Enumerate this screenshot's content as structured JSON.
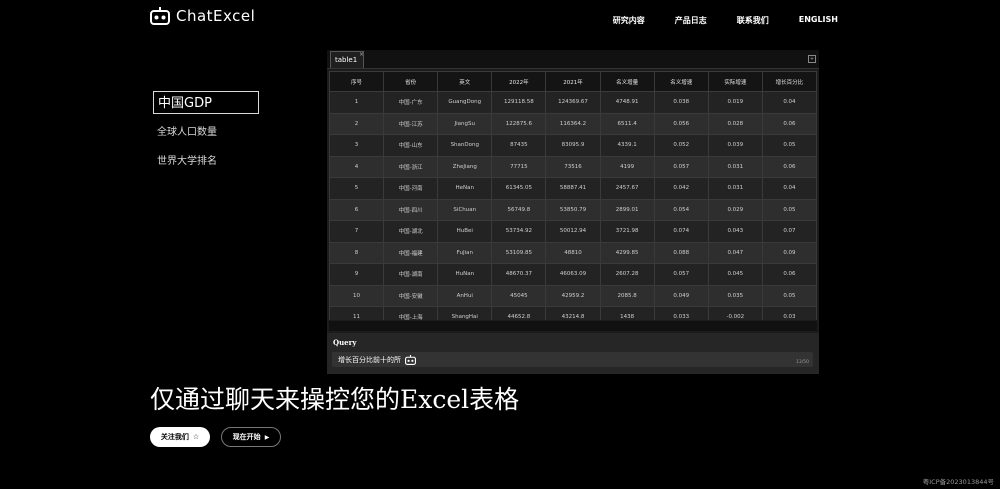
{
  "header": {
    "logo_text": "ChatExcel",
    "nav": [
      "研究内容",
      "产品日志",
      "联系我们",
      "ENGLISH"
    ]
  },
  "sidebar": {
    "items": [
      "中国GDP",
      "全球人口数量",
      "世界大学排名"
    ],
    "active_index": 0
  },
  "sheet": {
    "tab_name": "table1",
    "columns": [
      "序号",
      "省份",
      "英文",
      "2022年",
      "2021年",
      "名义增量",
      "名义增速",
      "实际增速",
      "增长百分比"
    ],
    "rows": [
      [
        "1",
        "中国-广东",
        "GuangDong",
        "129118.58",
        "124369.67",
        "4748.91",
        "0.038",
        "0.019",
        "0.04"
      ],
      [
        "2",
        "中国-江苏",
        "JiangSu",
        "122875.6",
        "116364.2",
        "6511.4",
        "0.056",
        "0.028",
        "0.06"
      ],
      [
        "3",
        "中国-山东",
        "ShanDong",
        "87435",
        "83095.9",
        "4339.1",
        "0.052",
        "0.039",
        "0.05"
      ],
      [
        "4",
        "中国-浙江",
        "ZheJiang",
        "77715",
        "73516",
        "4199",
        "0.057",
        "0.031",
        "0.06"
      ],
      [
        "5",
        "中国-河南",
        "HeNan",
        "61345.05",
        "58887.41",
        "2457.67",
        "0.042",
        "0.031",
        "0.04"
      ],
      [
        "6",
        "中国-四川",
        "SiChuan",
        "56749.8",
        "53850.79",
        "2899.01",
        "0.054",
        "0.029",
        "0.05"
      ],
      [
        "7",
        "中国-湖北",
        "HuBei",
        "53734.92",
        "50012.94",
        "3721.98",
        "0.074",
        "0.043",
        "0.07"
      ],
      [
        "8",
        "中国-福建",
        "FuJian",
        "53109.85",
        "48810",
        "4299.85",
        "0.088",
        "0.047",
        "0.09"
      ],
      [
        "9",
        "中国-湖南",
        "HuNan",
        "48670.37",
        "46063.09",
        "2607.28",
        "0.057",
        "0.045",
        "0.06"
      ],
      [
        "10",
        "中国-安徽",
        "AnHui",
        "45045",
        "42959.2",
        "2085.8",
        "0.049",
        "0.035",
        "0.05"
      ],
      [
        "11",
        "中国-上海",
        "ShangHai",
        "44652.8",
        "43214.8",
        "1438",
        "0.033",
        "-0.002",
        "0.03"
      ],
      [
        "12",
        "中国-河北",
        "HeBei",
        "42370.4",
        "40391.3",
        "1979.1",
        "0.049",
        "0.038",
        "0.05"
      ]
    ]
  },
  "query": {
    "label": "Query",
    "text": "增长百分比前十的所",
    "counter": "13/50"
  },
  "hero": {
    "headline": "仅通过聊天来操控您的Excel表格",
    "follow_label": "关注我们",
    "start_label": "现在开始"
  },
  "footer": {
    "icp": "粤ICP备2023013844号"
  },
  "colors": {
    "background": "#000000",
    "panel": "#1c1c1c",
    "row_odd": "#232323",
    "row_even": "#2e2e2e"
  }
}
